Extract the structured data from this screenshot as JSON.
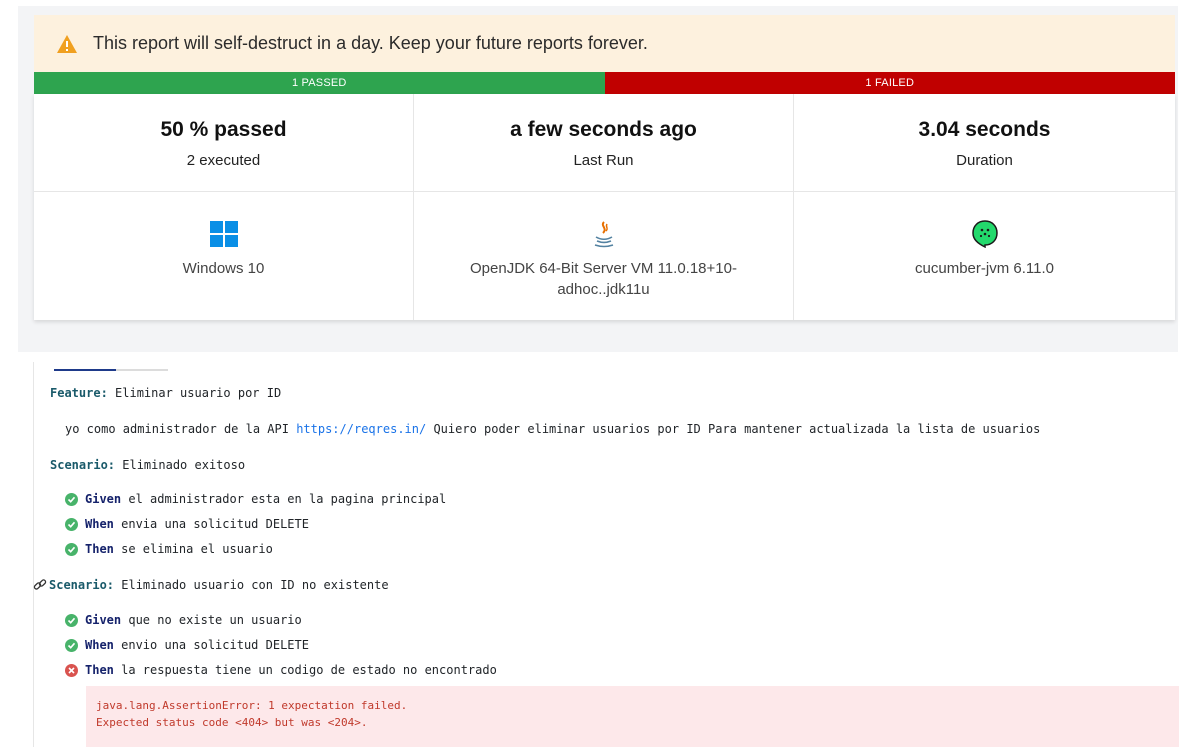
{
  "banner": {
    "text": "This report will self-destruct in a day. Keep your future reports forever.",
    "icon": "warning-icon",
    "bg_color": "#fdf1de",
    "icon_color": "#f0a020"
  },
  "progress": {
    "passed_label": "1 PASSED",
    "failed_label": "1 FAILED",
    "passed_fraction": 0.5,
    "passed_color": "#2ea44f",
    "failed_color": "#c00000"
  },
  "stats": [
    {
      "value": "50 % passed",
      "label": "2 executed"
    },
    {
      "value": "a few seconds ago",
      "label": "Last Run"
    },
    {
      "value": "3.04 seconds",
      "label": "Duration"
    }
  ],
  "environment": [
    {
      "icon": "windows-icon",
      "name": "Windows 10"
    },
    {
      "icon": "java-icon",
      "name": "OpenJDK 64-Bit Server VM 11.0.18+10-adhoc..jdk11u"
    },
    {
      "icon": "cucumber-icon",
      "name": "cucumber-jvm 6.11.0"
    }
  ],
  "feature": {
    "keyword": "Feature:",
    "name": " Eliminar usuario por ID",
    "description_before": "yo como administrador de la API ",
    "description_link": "https://reqres.in/",
    "description_after": " Quiero poder eliminar usuarios por ID Para mantener actualizada la lista de usuarios"
  },
  "scenarios": [
    {
      "keyword": "Scenario:",
      "name": " Eliminado exitoso",
      "steps": [
        {
          "keyword": "Given",
          "text": " el administrador esta en la pagina principal",
          "status": "passed"
        },
        {
          "keyword": "When",
          "text": " envia una solicitud DELETE",
          "status": "passed"
        },
        {
          "keyword": "Then",
          "text": " se elimina el usuario",
          "status": "passed"
        }
      ]
    },
    {
      "keyword": "Scenario:",
      "name": " Eliminado usuario con ID no existente",
      "steps": [
        {
          "keyword": "Given",
          "text": " que no existe un usuario",
          "status": "passed"
        },
        {
          "keyword": "When",
          "text": " envio una solicitud DELETE",
          "status": "passed"
        },
        {
          "keyword": "Then",
          "text": " la respuesta tiene un codigo de estado no encontrado",
          "status": "failed"
        }
      ]
    }
  ],
  "error": {
    "line1": "java.lang.AssertionError: 1 expectation failed.",
    "line2": "Expected status code <404> but was <204>."
  }
}
